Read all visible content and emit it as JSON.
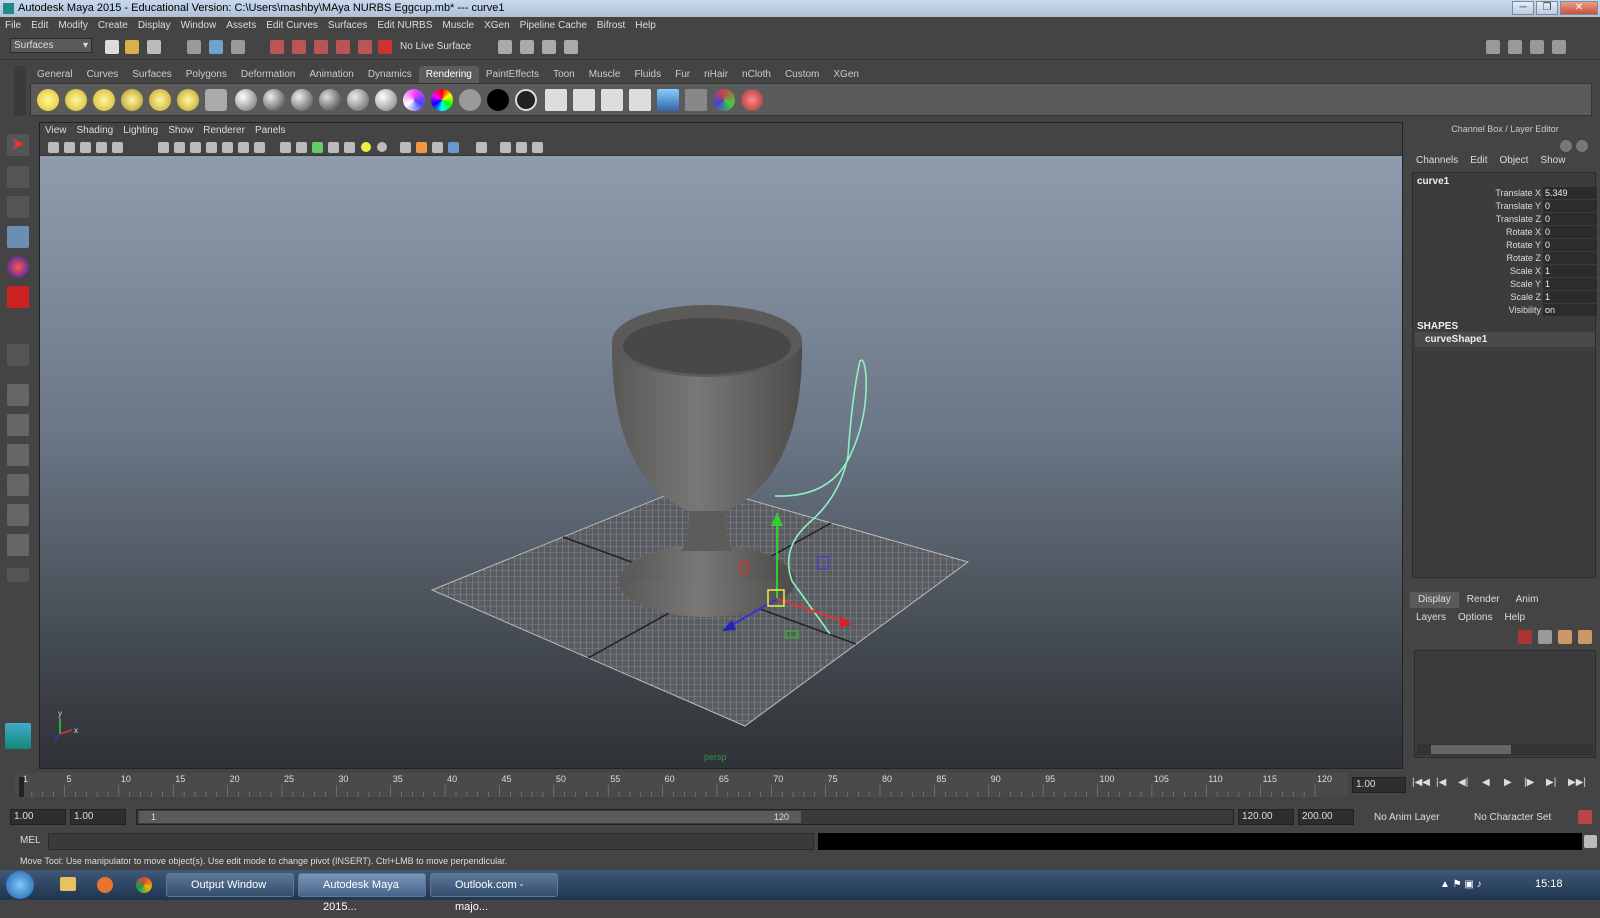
{
  "window": {
    "title": "Autodesk Maya 2015 - Educational Version: C:\\Users\\mashby\\MAya NURBS Eggcup.mb*   ---   curve1",
    "controls": [
      "─",
      "❐",
      "✕"
    ]
  },
  "menubar": [
    "File",
    "Edit",
    "Modify",
    "Create",
    "Display",
    "Window",
    "Assets",
    "Edit Curves",
    "Surfaces",
    "Edit NURBS",
    "Muscle",
    "XGen",
    "Pipeline Cache",
    "Bifrost",
    "Help"
  ],
  "statusline": {
    "menu_set": "Surfaces",
    "live_surface": "No Live Surface"
  },
  "shelf": {
    "tabs": [
      "General",
      "Curves",
      "Surfaces",
      "Polygons",
      "Deformation",
      "Animation",
      "Dynamics",
      "Rendering",
      "PaintEffects",
      "Toon",
      "Muscle",
      "Fluids",
      "Fur",
      "nHair",
      "nCloth",
      "Custom",
      "XGen"
    ],
    "active_tab": "Rendering"
  },
  "viewport": {
    "menu": [
      "View",
      "Shading",
      "Lighting",
      "Show",
      "Renderer",
      "Panels"
    ],
    "camera": "persp",
    "axis_x": "x",
    "axis_y": "y"
  },
  "channel_box": {
    "title": "Channel Box / Layer Editor",
    "menu": [
      "Channels",
      "Edit",
      "Object",
      "Show"
    ],
    "object": "curve1",
    "attributes": [
      {
        "label": "Translate X",
        "value": "5.349"
      },
      {
        "label": "Translate Y",
        "value": "0"
      },
      {
        "label": "Translate Z",
        "value": "0"
      },
      {
        "label": "Rotate X",
        "value": "0"
      },
      {
        "label": "Rotate Y",
        "value": "0"
      },
      {
        "label": "Rotate Z",
        "value": "0"
      },
      {
        "label": "Scale X",
        "value": "1"
      },
      {
        "label": "Scale Y",
        "value": "1"
      },
      {
        "label": "Scale Z",
        "value": "1"
      },
      {
        "label": "Visibility",
        "value": "on"
      }
    ],
    "shapes_header": "SHAPES",
    "shape": "curveShape1"
  },
  "layer_editor": {
    "tabs": [
      "Display",
      "Render",
      "Anim"
    ],
    "active_tab": "Display",
    "menu": [
      "Layers",
      "Options",
      "Help"
    ]
  },
  "timeslider": {
    "ticks": [
      "1",
      "5",
      "10",
      "15",
      "20",
      "25",
      "30",
      "35",
      "40",
      "45",
      "50",
      "55",
      "60",
      "65",
      "70",
      "75",
      "80",
      "85",
      "90",
      "95",
      "100",
      "105",
      "110",
      "115",
      "120"
    ],
    "current_frame": "1.00",
    "playback_controls": [
      "|◀◀",
      "|◀",
      "◀|",
      "◀",
      "▶",
      "|▶",
      "▶|",
      "▶▶|"
    ]
  },
  "range": {
    "start": "1.00",
    "playback_start": "1.00",
    "slider_start": "1",
    "slider_end": "120",
    "playback_end": "120.00",
    "end": "200.00",
    "anim_layer": "No Anim Layer",
    "character_set": "No Character Set"
  },
  "command_line": {
    "label": "MEL"
  },
  "help_line": "Move Tool: Use manipulator to move object(s). Use edit mode to change pivot (INSERT). Ctrl+LMB to move perpendicular.",
  "taskbar": {
    "tasks": [
      {
        "label": "Output Window",
        "active": false
      },
      {
        "label": "Autodesk Maya 2015...",
        "active": true
      },
      {
        "label": "Outlook.com - majo...",
        "active": false
      }
    ],
    "clock": "15:18"
  }
}
